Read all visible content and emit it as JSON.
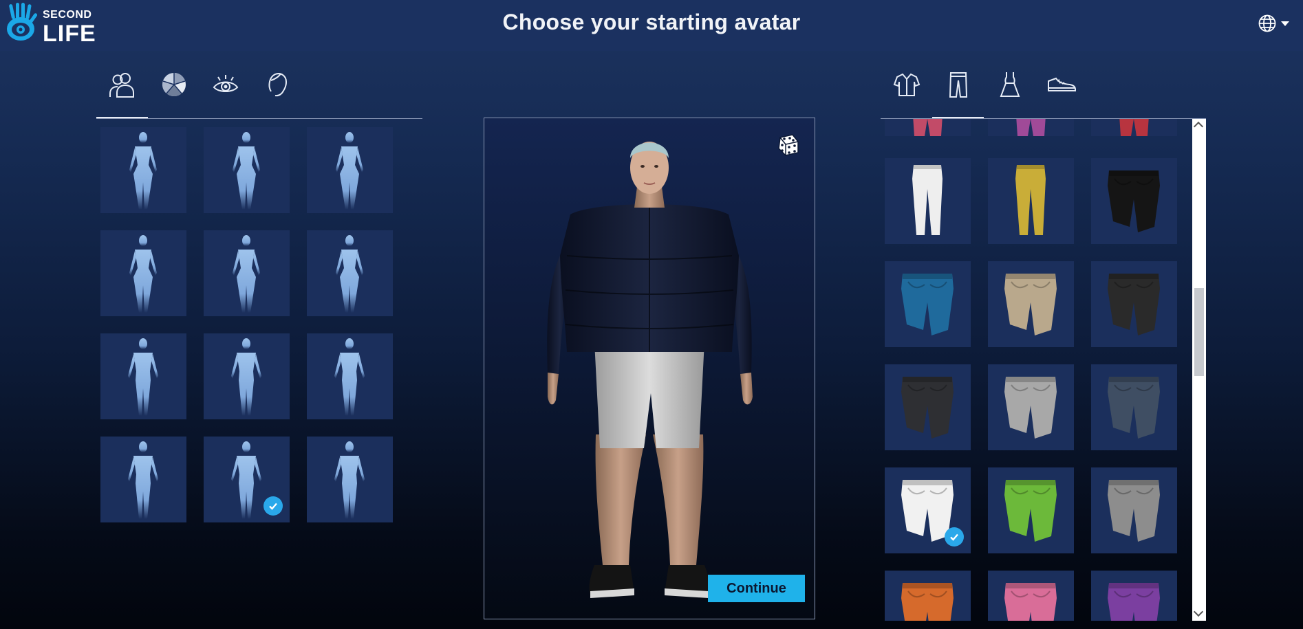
{
  "header": {
    "brand_top": "SECOND",
    "brand_bottom": "LIFE",
    "title": "Choose your starting avatar",
    "language_icon": "globe-icon"
  },
  "left_panel": {
    "tabs": [
      {
        "icon": "body-shapes-icon",
        "active": true
      },
      {
        "icon": "skin-icon",
        "active": false
      },
      {
        "icon": "eyes-icon",
        "active": false
      },
      {
        "icon": "head-icon",
        "active": false
      }
    ],
    "selected_index": 10
  },
  "preview": {
    "randomize_icon": "dice-icon",
    "continue_label": "Continue"
  },
  "right_panel": {
    "tabs": [
      {
        "icon": "shirt-icon",
        "active": false
      },
      {
        "icon": "pants-icon",
        "active": true
      },
      {
        "icon": "dress-icon",
        "active": false
      },
      {
        "icon": "shoe-icon",
        "active": false
      }
    ],
    "top_row_colors": [
      "#c24b68",
      "#a04a98",
      "#b8343f"
    ],
    "items": [
      {
        "color": "#eeeeee",
        "kind": "pants"
      },
      {
        "color": "#c9ad38",
        "kind": "pants"
      },
      {
        "color": "#151515",
        "kind": "shorts"
      },
      {
        "color": "#1f6a9c",
        "kind": "shorts"
      },
      {
        "color": "#b9a88c",
        "kind": "shorts"
      },
      {
        "color": "#2a2a2a",
        "kind": "shorts"
      },
      {
        "color": "#2e2f33",
        "kind": "shorts"
      },
      {
        "color": "#a8a8a8",
        "kind": "shorts"
      },
      {
        "color": "#3f4e63",
        "kind": "shorts"
      },
      {
        "color": "#f1f1f1",
        "kind": "shorts"
      },
      {
        "color": "#6cb93a",
        "kind": "shorts"
      },
      {
        "color": "#8d8d8d",
        "kind": "shorts"
      },
      {
        "color": "#d66a2c",
        "kind": "shorts"
      },
      {
        "color": "#d96d98",
        "kind": "shorts"
      },
      {
        "color": "#7b3fa0",
        "kind": "shorts"
      }
    ],
    "selected_index": 9
  },
  "colors": {
    "accent": "#1fb2ea",
    "tile": "#1b2f5c",
    "header": "#1b3160"
  }
}
